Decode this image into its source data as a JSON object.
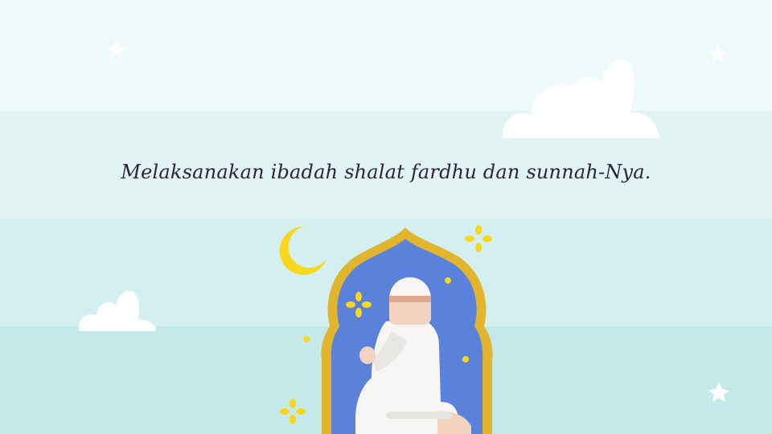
{
  "slide": {
    "caption": "Melaksanakan ibadah shalat fardhu dan sunnah-Nya.",
    "colors": {
      "band_top": "#eef9fa",
      "band_2": "#e1f3f3",
      "band_3": "#d4efef",
      "band_bottom": "#c5e8e9",
      "text": "#2b2340",
      "window_frame": "#e2b52f",
      "window_fill": "#5a82db",
      "moon_star": "#f7d81f",
      "robe": "#f6f5f3",
      "skin": "#f3d2c0"
    },
    "icons": [
      "crescent-moon-icon",
      "sparkle-icon",
      "star-icon",
      "cloud-icon",
      "praying-man-illustration",
      "mosque-window-arch"
    ]
  }
}
